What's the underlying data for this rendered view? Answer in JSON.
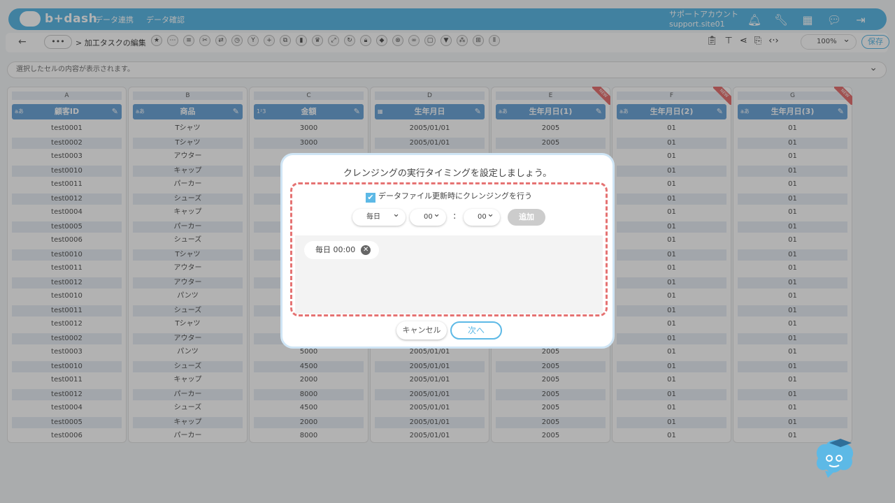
{
  "brand": {
    "name": "b+dash"
  },
  "nav": [
    "データ連携",
    "データ確認"
  ],
  "account": {
    "line1": "サポートアカウント",
    "line2": "support.site01"
  },
  "header_icons": [
    "bell-icon",
    "wrench-icon",
    "apps-grid-icon",
    "chat-icon",
    "logout-icon"
  ],
  "toolbar": {
    "more": "•••",
    "breadcrumb": "> 加工タスクの編集",
    "zoom": "100%",
    "save": "保存"
  },
  "cellbar": {
    "placeholder": "選択したセルの内容が表示されます。"
  },
  "columns": [
    {
      "letter": "A",
      "type": "aあ",
      "name": "顧客ID",
      "isnew": false,
      "cells": [
        "test0001",
        "test0002",
        "test0003",
        "test0010",
        "test0011",
        "test0012",
        "test0004",
        "test0005",
        "test0006",
        "test0010",
        "test0011",
        "test0012",
        "test0010",
        "test0011",
        "test0012",
        "test0002",
        "test0003",
        "test0010",
        "test0011",
        "test0012",
        "test0004",
        "test0005",
        "test0006"
      ]
    },
    {
      "letter": "B",
      "type": "aあ",
      "name": "商品",
      "isnew": false,
      "cells": [
        "Tシャツ",
        "Tシャツ",
        "アウター",
        "キャップ",
        "パーカー",
        "シューズ",
        "キャップ",
        "パーカー",
        "シューズ",
        "Tシャツ",
        "アウター",
        "アウター",
        "パンツ",
        "シューズ",
        "Tシャツ",
        "アウター",
        "パンツ",
        "シューズ",
        "キャップ",
        "パーカー",
        "シューズ",
        "キャップ",
        "パーカー"
      ]
    },
    {
      "letter": "C",
      "type": "1²3",
      "name": "金額",
      "isnew": false,
      "cells": [
        "3000",
        "3000",
        "",
        "",
        "",
        "",
        "",
        "",
        "",
        "",
        "",
        "",
        "",
        "",
        "",
        "",
        "5000",
        "4500",
        "2000",
        "8000",
        "4500",
        "2000",
        "8000"
      ]
    },
    {
      "letter": "D",
      "type": "▦",
      "name": "生年月日",
      "isnew": false,
      "cells": [
        "2005/01/01",
        "2005/01/01",
        "",
        "",
        "",
        "",
        "",
        "",
        "",
        "",
        "",
        "",
        "",
        "",
        "",
        "",
        "2005/01/01",
        "2005/01/01",
        "2005/01/01",
        "2005/01/01",
        "2005/01/01",
        "2005/01/01",
        "2005/01/01"
      ]
    },
    {
      "letter": "E",
      "type": "aあ",
      "name": "生年月日(1)",
      "isnew": true,
      "cells": [
        "2005",
        "2005",
        "",
        "",
        "",
        "",
        "",
        "",
        "",
        "",
        "",
        "",
        "",
        "",
        "",
        "",
        "2005",
        "2005",
        "2005",
        "2005",
        "2005",
        "2005",
        "2005"
      ]
    },
    {
      "letter": "F",
      "type": "aあ",
      "name": "生年月日(2)",
      "isnew": true,
      "cells": [
        "01",
        "01",
        "01",
        "01",
        "01",
        "01",
        "01",
        "01",
        "01",
        "01",
        "01",
        "01",
        "01",
        "01",
        "01",
        "01",
        "01",
        "01",
        "01",
        "01",
        "01",
        "01",
        "01"
      ]
    },
    {
      "letter": "G",
      "type": "aあ",
      "name": "生年月日(3)",
      "isnew": true,
      "cells": [
        "01",
        "01",
        "01",
        "01",
        "01",
        "01",
        "01",
        "01",
        "01",
        "01",
        "01",
        "01",
        "01",
        "01",
        "01",
        "01",
        "01",
        "01",
        "01",
        "01",
        "01",
        "01",
        "01"
      ]
    }
  ],
  "new_badge": "NEW",
  "modal": {
    "title": "クレンジングの実行タイミングを設定しましょう。",
    "checkbox_label": "データファイル更新時にクレンジングを行う",
    "checkbox_checked": true,
    "freq": "毎日",
    "hour": "00",
    "colon": ":",
    "minute": "00",
    "add": "追加",
    "schedule": "毎日 00:00",
    "cancel": "キャンセル",
    "next": "次へ"
  }
}
